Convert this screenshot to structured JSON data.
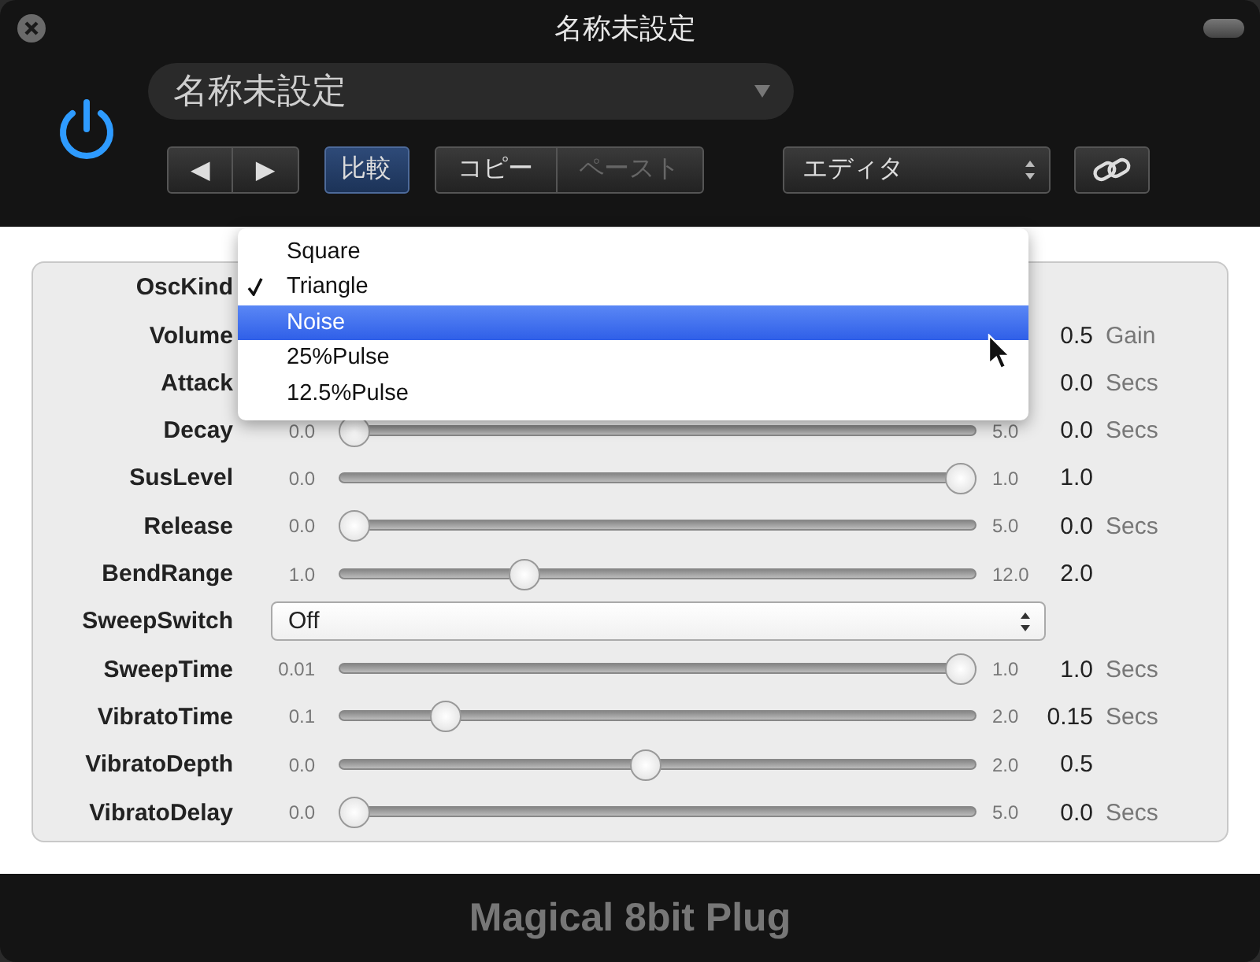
{
  "window": {
    "title": "名称未設定"
  },
  "preset": {
    "name": "名称未設定"
  },
  "nav_buttons": [
    "◀",
    "▶"
  ],
  "compare": {
    "label": "比較",
    "selected": true
  },
  "clipboard": [
    {
      "label": "コピー",
      "disabled": false
    },
    {
      "label": "ペースト",
      "disabled": true
    }
  ],
  "view_menu": {
    "value": "エディタ"
  },
  "params": [
    {
      "kind": "select",
      "label": "OscKind"
    },
    {
      "kind": "slider",
      "label": "Volume",
      "value": "0.5",
      "unit": "Gain"
    },
    {
      "kind": "slider",
      "label": "Attack",
      "value": "0.0",
      "unit": "Secs"
    },
    {
      "kind": "slider",
      "label": "Decay",
      "min": "0.0",
      "max": "5.0",
      "level": 0,
      "value": "0.0",
      "unit": "Secs"
    },
    {
      "kind": "slider",
      "label": "SusLevel",
      "min": "0.0",
      "max": "1.0",
      "level": 1,
      "value": "1.0"
    },
    {
      "kind": "slider",
      "label": "Release",
      "min": "0.0",
      "max": "5.0",
      "level": 0,
      "value": "0.0",
      "unit": "Secs"
    },
    {
      "kind": "slider",
      "label": "BendRange",
      "min": "1.0",
      "max": "12.0",
      "level": 0.28,
      "value": "2.0"
    },
    {
      "kind": "select",
      "label": "SweepSwitch",
      "value": "Off"
    },
    {
      "kind": "slider",
      "label": "SweepTime",
      "min": "0.01",
      "max": "1.0",
      "level": 1,
      "value": "1.0",
      "unit": "Secs"
    },
    {
      "kind": "slider",
      "label": "VibratoTime",
      "min": "0.1",
      "max": "2.0",
      "level": 0.15,
      "value": "0.15",
      "unit": "Secs"
    },
    {
      "kind": "slider",
      "label": "VibratoDepth",
      "min": "0.0",
      "max": "2.0",
      "level": 0.48,
      "value": "0.5"
    },
    {
      "kind": "slider",
      "label": "VibratoDelay",
      "min": "0.0",
      "max": "5.0",
      "level": 0,
      "value": "0.0",
      "unit": "Secs"
    }
  ],
  "osc_menu": [
    {
      "label": "Square",
      "checked": false,
      "selected": false
    },
    {
      "label": "Triangle",
      "checked": true,
      "selected": false
    },
    {
      "label": "Noise",
      "checked": false,
      "selected": true
    },
    {
      "label": "25%Pulse",
      "checked": false,
      "selected": false
    },
    {
      "label": "12.5%Pulse",
      "checked": false,
      "selected": false
    }
  ],
  "footer": {
    "text": "Magical 8bit Plug"
  }
}
